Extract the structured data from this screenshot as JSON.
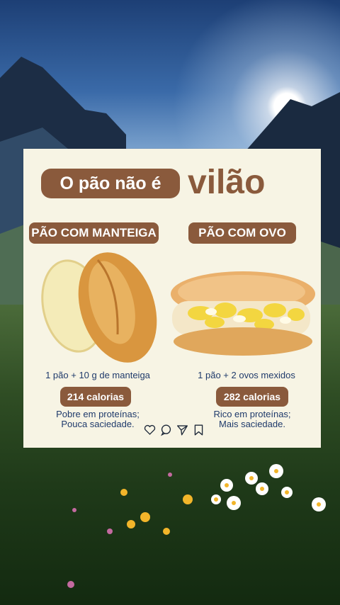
{
  "card": {
    "title_pill": "O pão não é",
    "title_big": "vilão",
    "left": {
      "label": "PÃO COM MANTEIGA",
      "description": "1 pão + 10 g de manteiga",
      "calories": "214 calorias",
      "note_line1": "Pobre em proteínas;",
      "note_line2": "Pouca saciedade."
    },
    "right": {
      "label": "PÃO COM OVO",
      "description": "1 pão + 2 ovos mexidos",
      "calories": "282 calorias",
      "note_line1": "Rico em proteínas;",
      "note_line2": "Mais saciedade."
    }
  },
  "icons": [
    "heart-icon",
    "comment-icon",
    "share-icon",
    "bookmark-icon"
  ],
  "colors": {
    "accent": "#8a5a3c",
    "card_bg": "#f7f4e4",
    "text_blue": "#1f3a6b"
  }
}
